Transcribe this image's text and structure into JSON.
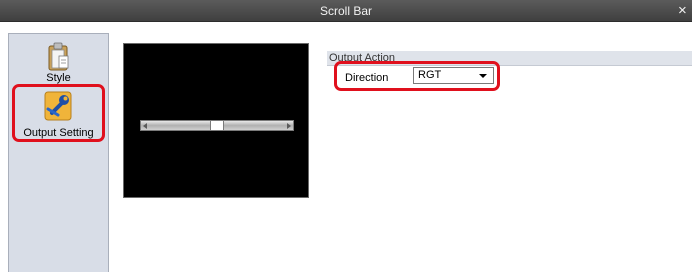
{
  "window": {
    "title": "Scroll Bar",
    "close_icon": "×"
  },
  "sidebar": {
    "items": [
      {
        "label": "Style",
        "icon": "clipboard-icon",
        "selected": false
      },
      {
        "label": "Output Setting",
        "icon": "wrench-icon",
        "selected": true
      }
    ]
  },
  "preview": {
    "scrollbar_thumb_position": 0.5
  },
  "output_action": {
    "header": "Output Action",
    "direction_label": "Direction",
    "direction_value": "RGT"
  },
  "colors": {
    "titlebar": "#4a4a4a",
    "sidebar": "#d8dde7",
    "highlight": "#e0101d",
    "preview_bg": "#000000"
  }
}
